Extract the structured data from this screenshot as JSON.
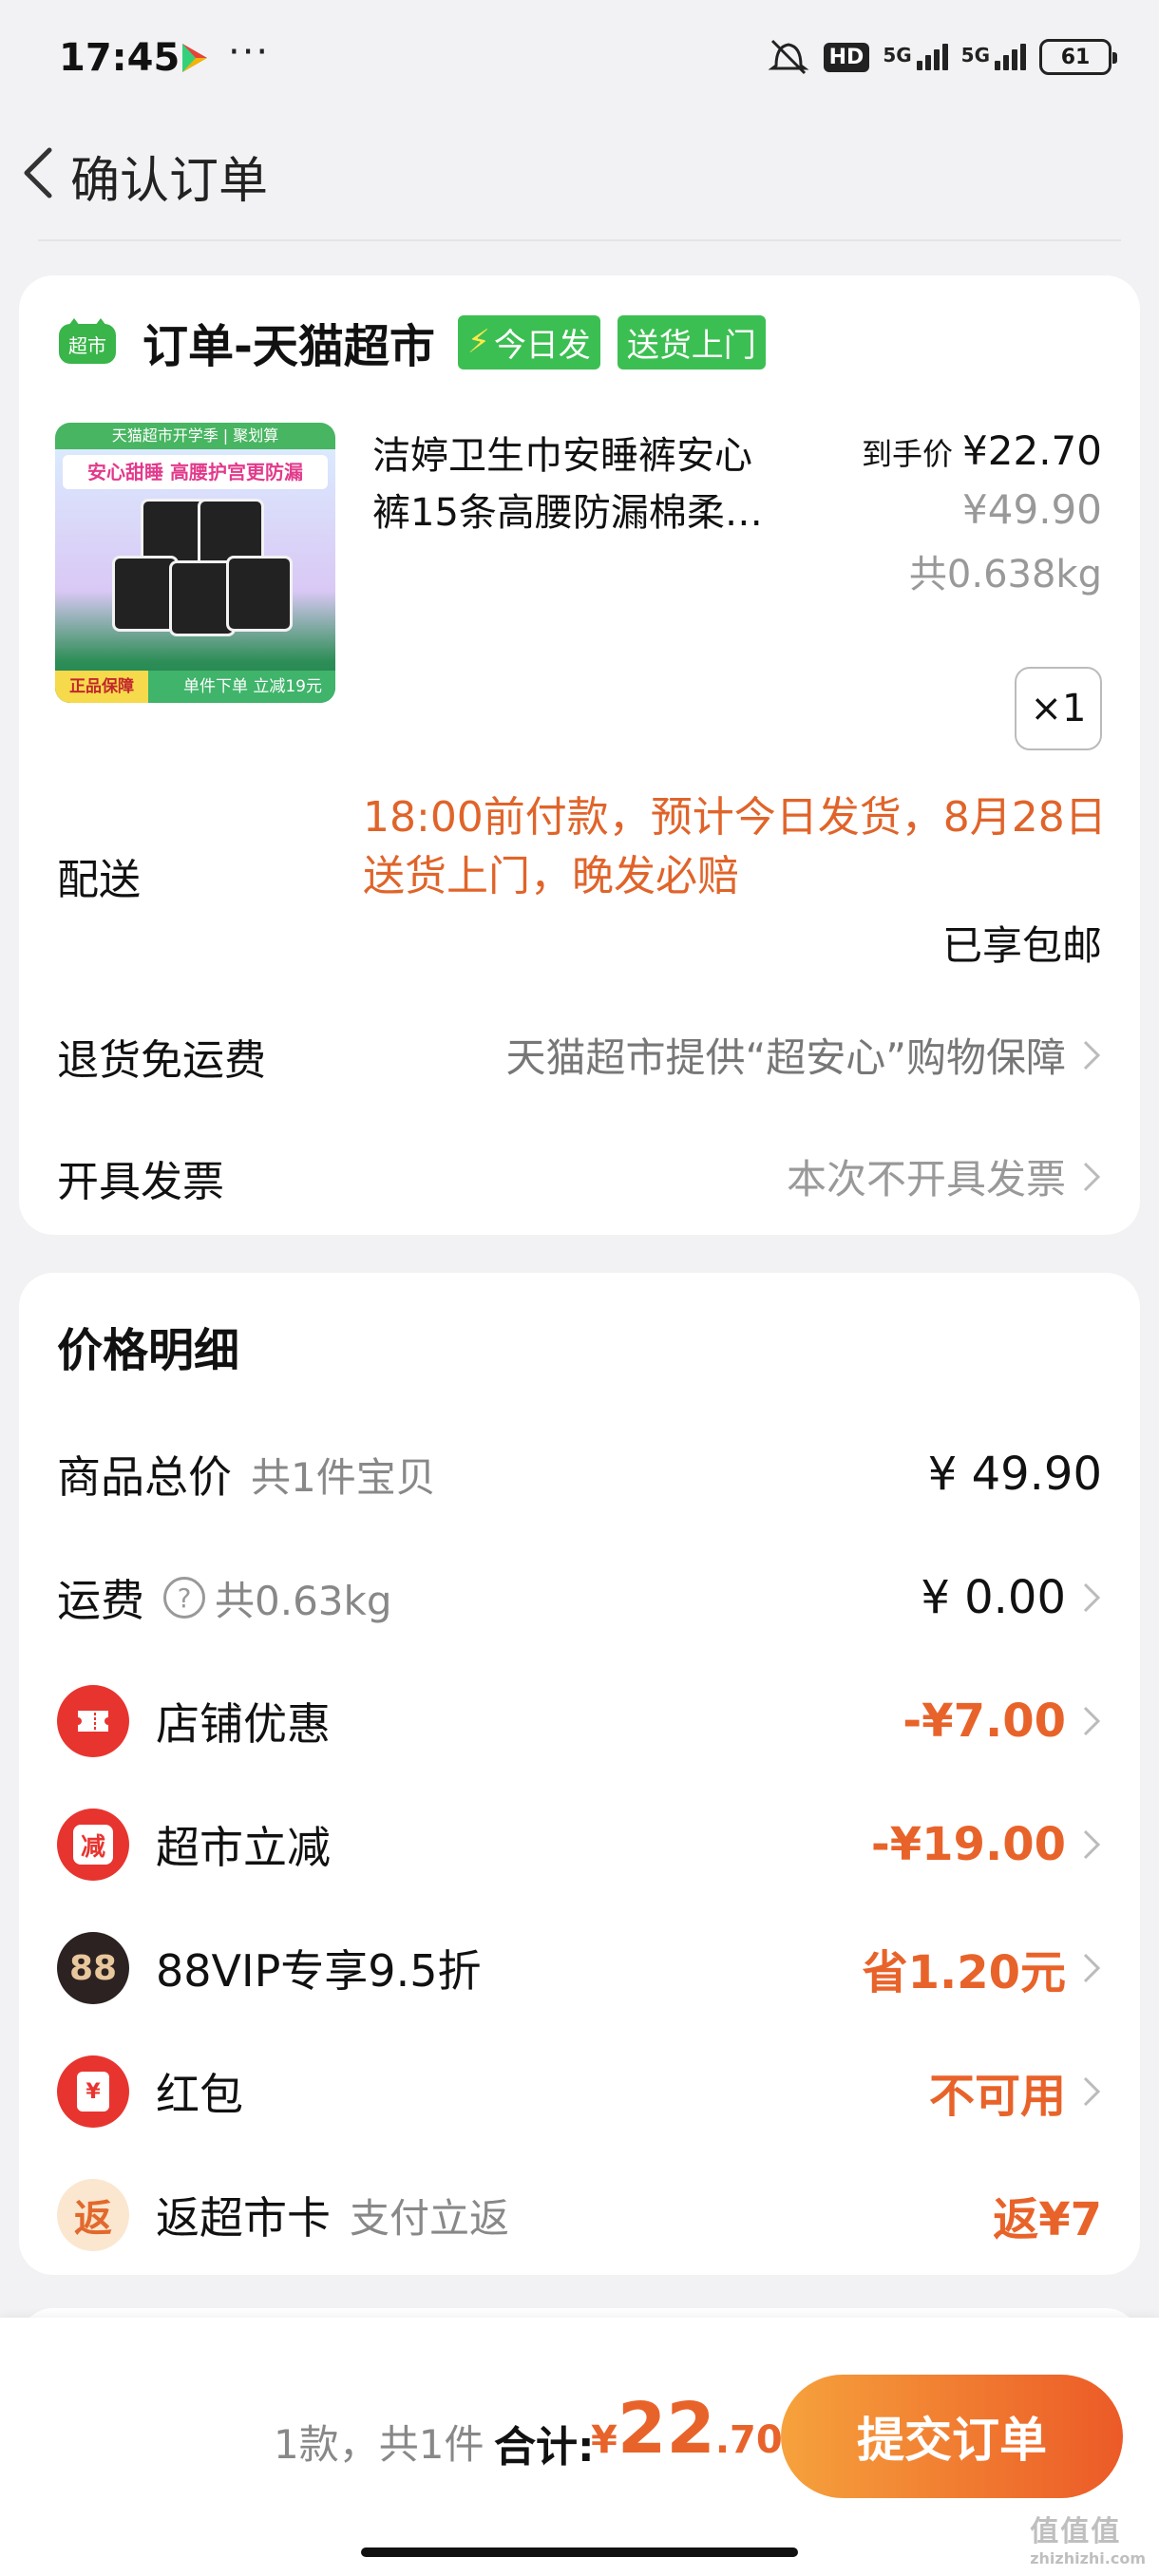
{
  "status_bar": {
    "time": "17:45",
    "dots": "···",
    "hd": "HD",
    "signal1": "5G",
    "signal2": "5G",
    "battery": "61"
  },
  "nav": {
    "title": "确认订单"
  },
  "order": {
    "store_name": "订单-天猫超市",
    "store_logo_text": "超市",
    "tag_today": "今日发",
    "tag_delivery": "送货上门",
    "product": {
      "title_line1": "洁婷卫生巾安睡裤安心",
      "title_line2": "裤15条高腰防漏棉柔…",
      "final_price_label": "到手价",
      "final_price": "¥22.70",
      "original_price": "¥49.90",
      "weight": "共0.638kg",
      "quantity": "×1",
      "image_texts": {
        "banner": "天猫超市开学季 | 聚划算",
        "headline": "安心甜睡 高腰护宫更防漏",
        "badge": "正品保障",
        "bottom": "单件下单 立减19元"
      }
    },
    "delivery_label": "配送",
    "delivery_note": "18:00前付款，预计今日发货，8月28日送货上门，晚发必赔",
    "free_shipping": "已享包邮",
    "return_label": "退货免运费",
    "return_value": "天猫超市提供“超安心”购物保障",
    "invoice_label": "开具发票",
    "invoice_value": "本次不开具发票"
  },
  "price_detail": {
    "title": "价格明细",
    "rows": [
      {
        "label": "商品总价",
        "sub": "共1件宝贝",
        "value": "¥ 49.90"
      },
      {
        "label": "运费",
        "sub": "共0.63kg",
        "value": "¥ 0.00",
        "help": "?"
      },
      {
        "label": "店铺优惠",
        "value": "-¥7.00"
      },
      {
        "label": "超市立减",
        "icon_text": "减",
        "value": "-¥19.00"
      },
      {
        "label": "88VIP专享9.5折",
        "icon_text": "88",
        "value": "省1.20元"
      },
      {
        "label": "红包",
        "icon_text": "¥",
        "value": "不可用"
      },
      {
        "label": "返超市卡",
        "sub": "支付立返",
        "icon_text": "返",
        "value": "返¥7"
      }
    ]
  },
  "bottom_bar": {
    "count": "1款，共1件",
    "total_label": "合计:",
    "currency": "¥",
    "total_int": "22",
    "total_dec": ".70",
    "submit": "提交订单"
  },
  "watermark": {
    "main": "值值值",
    "sub": "zhizhizhi.com"
  },
  "colors": {
    "accent": "#e8632a",
    "green_tag": "#3cbf52",
    "red_icon": "#e8342f"
  }
}
